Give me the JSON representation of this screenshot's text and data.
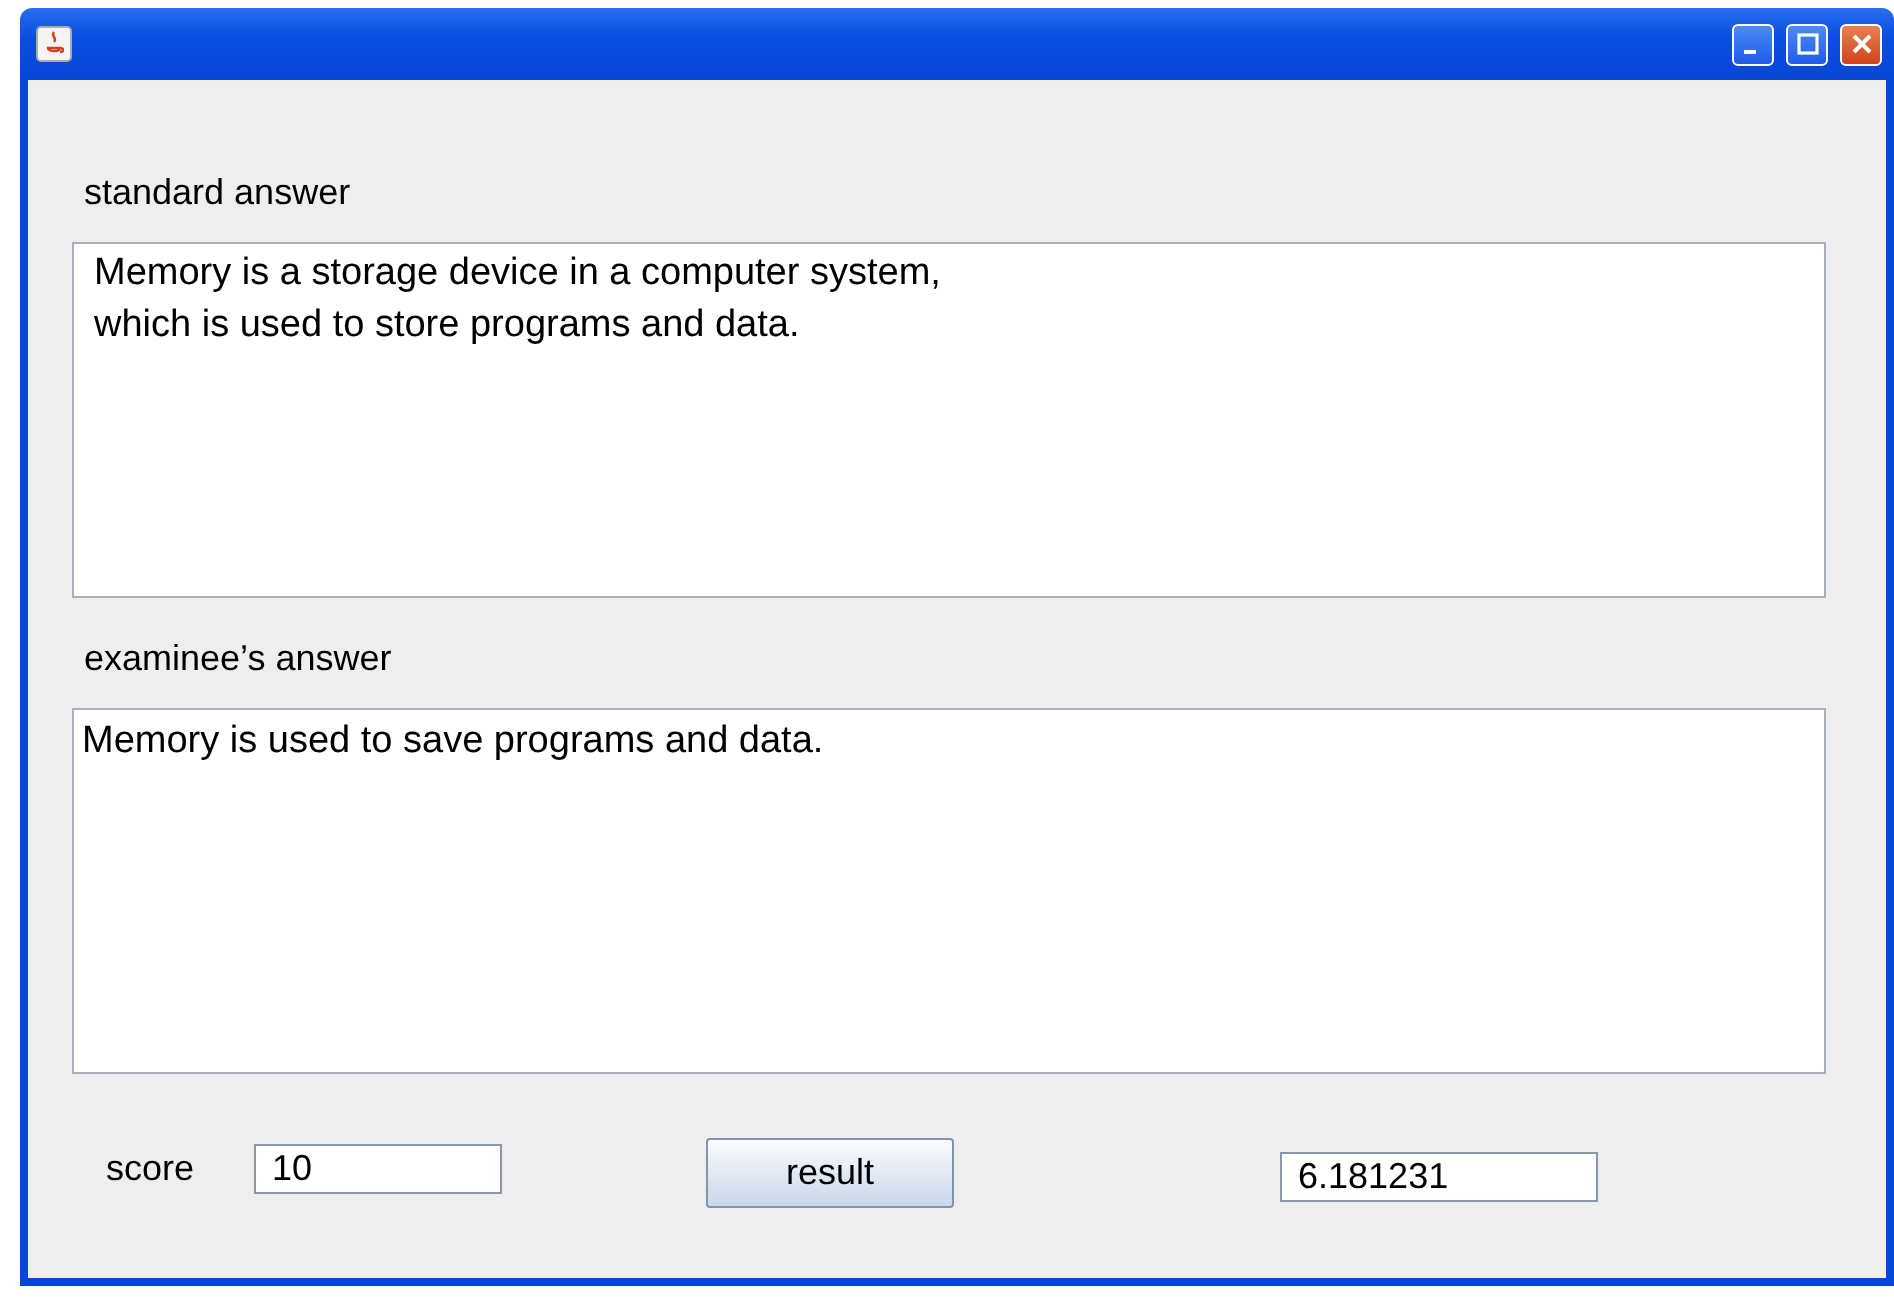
{
  "standard_answer": {
    "label": "standard answer",
    "text": "Memory is a storage device in a computer system,\nwhich is used to store programs and data."
  },
  "examinee_answer": {
    "label": "examinee’s answer",
    "text": "Memory is used to save programs and data."
  },
  "score": {
    "label": "score",
    "value": "10"
  },
  "buttons": [
    "result"
  ],
  "result_field": {
    "value": "6.181231"
  }
}
